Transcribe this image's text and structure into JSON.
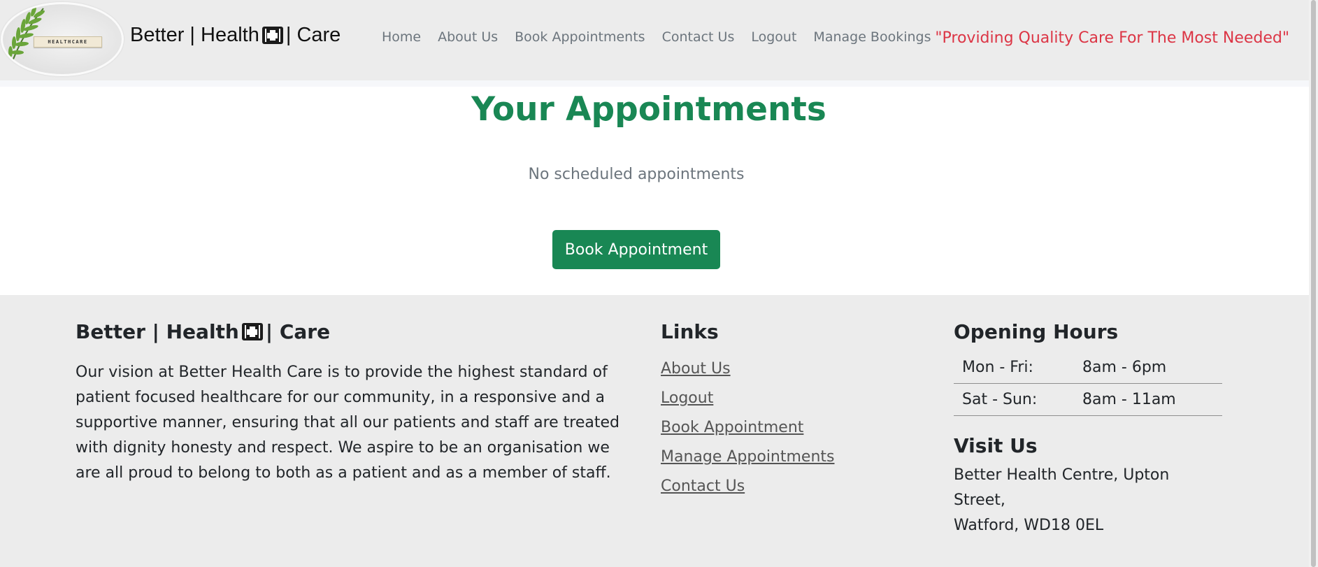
{
  "header": {
    "logo_text": "HEALTHCARE",
    "brand_left": "Better | Health ",
    "brand_right": " | Care",
    "nav": [
      {
        "label": "Home"
      },
      {
        "label": "About Us"
      },
      {
        "label": "Book Appointments"
      },
      {
        "label": "Contact Us"
      },
      {
        "label": "Logout"
      },
      {
        "label": "Manage Bookings"
      }
    ],
    "tagline": "\"Providing Quality Care For The Most Needed\""
  },
  "main": {
    "title": "Your Appointments",
    "empty_message": "No scheduled appointments",
    "book_button": "Book Appointment"
  },
  "footer": {
    "about": {
      "heading_left": "Better | Health ",
      "heading_right": " | Care",
      "text": "Our vision at Better Health Care is to provide the highest standard of patient focused healthcare for our community, in a responsive and a supportive manner, ensuring that all our patients and staff are treated with dignity honesty and respect. We aspire to be an organisation we are all proud to belong to both as a patient and as a member of staff."
    },
    "links": {
      "heading": "Links",
      "items": [
        {
          "label": "About Us"
        },
        {
          "label": "Logout"
        },
        {
          "label": "Book Appointment"
        },
        {
          "label": "Manage Appointments"
        },
        {
          "label": "Contact Us"
        }
      ]
    },
    "hours": {
      "heading": "Opening Hours",
      "rows": [
        {
          "day": "Mon - Fri:",
          "time": "8am - 6pm"
        },
        {
          "day": "Sat - Sun:",
          "time": "8am - 11am"
        }
      ]
    },
    "visit": {
      "heading": "Visit Us",
      "address_line1": "Better Health Centre, Upton Street,",
      "address_line2": "Watford, WD18 0EL"
    }
  },
  "colors": {
    "accent_green": "#198754",
    "tagline_red": "#dc3545",
    "nav_gray": "#6c757d",
    "background_gray": "#ececec"
  },
  "icons": {
    "brand_icon": "medical-kit-icon",
    "logo_image": "fern-leaf-with-letter-tiles"
  }
}
